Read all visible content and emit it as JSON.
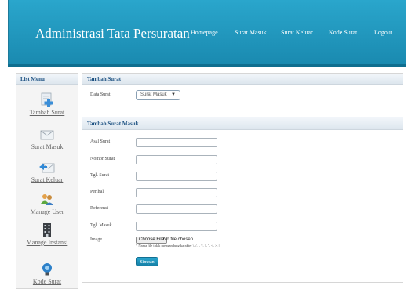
{
  "header": {
    "title": "Administrasi Tata Persuratan",
    "nav": [
      "Homepage",
      "Surat Masuk",
      "Surat Keluar",
      "Kode Surat",
      "Logout"
    ]
  },
  "sidebar": {
    "title": "List Menu",
    "items": [
      {
        "label": "Tambah Surat",
        "icon": "add-document-icon"
      },
      {
        "label": "Surat Masuk",
        "icon": "incoming-mail-icon"
      },
      {
        "label": "Surat Keluar",
        "icon": "outgoing-mail-icon"
      },
      {
        "label": "Manage User",
        "icon": "users-icon"
      },
      {
        "label": "Manage Instansi",
        "icon": "building-icon"
      },
      {
        "label": "Kode Surat",
        "icon": "lightbulb-icon"
      }
    ]
  },
  "tambah_panel": {
    "title": "Tambah Surat",
    "jenis_label": "Data Surat",
    "jenis_value": "Surat Masuk"
  },
  "form_panel": {
    "title": "Tambah Surat Masuk",
    "fields": [
      {
        "label": "Asal Surat",
        "value": ""
      },
      {
        "label": "Nomor Surat",
        "value": ""
      },
      {
        "label": "Tgl. Surat",
        "value": ""
      },
      {
        "label": "Perihal",
        "value": ""
      },
      {
        "label": "Referensi",
        "value": ""
      },
      {
        "label": "Tgl. Masuk",
        "value": ""
      }
    ],
    "image_label": "Image",
    "file_button": "Choose File",
    "file_status": "No file chosen",
    "file_hint": "* Nama file tidak mengandung karakter \\, /, :, *, ?, \", <, >, |",
    "submit_label": "Simpan"
  },
  "colors": {
    "header": "#1f97c0",
    "panel_title": "#1a4f80",
    "button": "#1d8fb8"
  }
}
